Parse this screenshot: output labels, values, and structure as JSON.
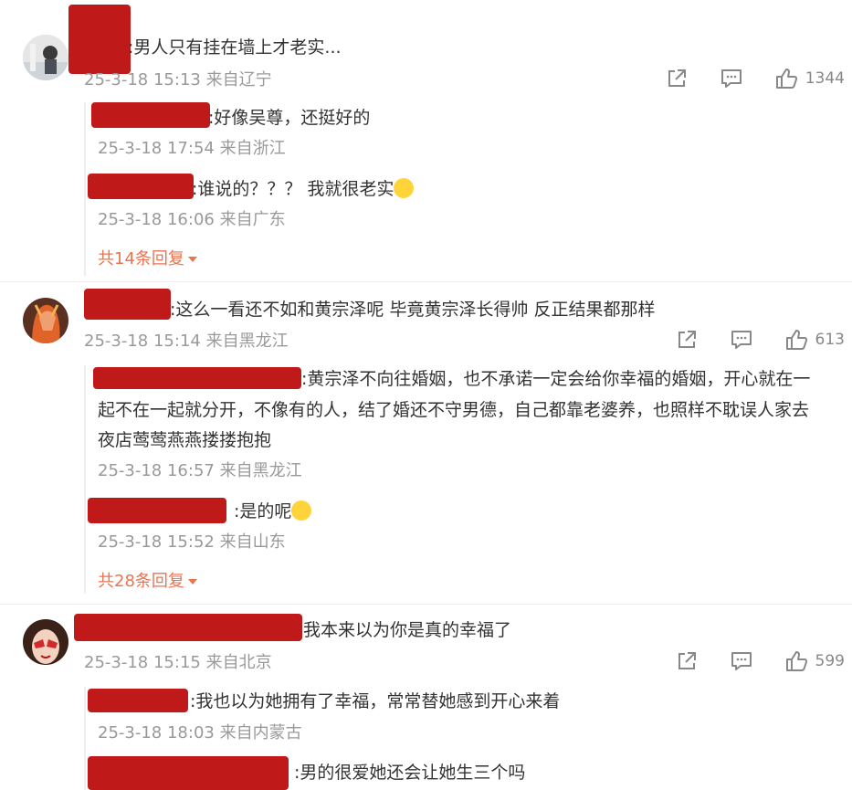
{
  "comments": [
    {
      "text": ":男人只有挂在墙上才老实...",
      "meta": "25-3-18 15:13 来自辽宁",
      "likes": "1344",
      "replies": [
        {
          "text": ":好像吴尊，还挺好的",
          "meta": "25-3-18 17:54 来自浙江"
        },
        {
          "text": ":谁说的？？？ 我就很老实",
          "meta": "25-3-18 16:06 来自广东"
        }
      ],
      "more": "共14条回复"
    },
    {
      "text": ":这么一看还不如和黄宗泽呢 毕竟黄宗泽长得帅 反正结果都那样",
      "meta": "25-3-18 15:14 来自黑龙江",
      "likes": "613",
      "replies": [
        {
          "line1": ":黄宗泽不向往婚姻，也不承诺一定会给你幸福的婚姻，开心就在一",
          "line2": "起不在一起就分开，不像有的人，结了婚还不守男德，自己都靠老婆养，也照样不耽误人家去",
          "line3": "夜店莺莺燕燕搂搂抱抱",
          "meta": "25-3-18 16:57 来自黑龙江"
        },
        {
          "text": ":是的呢",
          "meta": "25-3-18 15:52 来自山东"
        }
      ],
      "more": "共28条回复"
    },
    {
      "text": "我本来以为你是真的幸福了",
      "meta": "25-3-18 15:15 来自北京",
      "likes": "599",
      "replies": [
        {
          "text": ":我也以为她拥有了幸福，常常替她感到开心来着",
          "meta": "25-3-18 18:03 来自内蒙古"
        },
        {
          "text": ":男的很爱她还会让她生三个吗"
        }
      ]
    }
  ],
  "icons": {
    "share": "share-icon",
    "comment": "comment-icon",
    "like": "like-icon"
  },
  "colors": {
    "redaction": "#c0191a",
    "meta": "#999999",
    "more": "#eb7350"
  }
}
